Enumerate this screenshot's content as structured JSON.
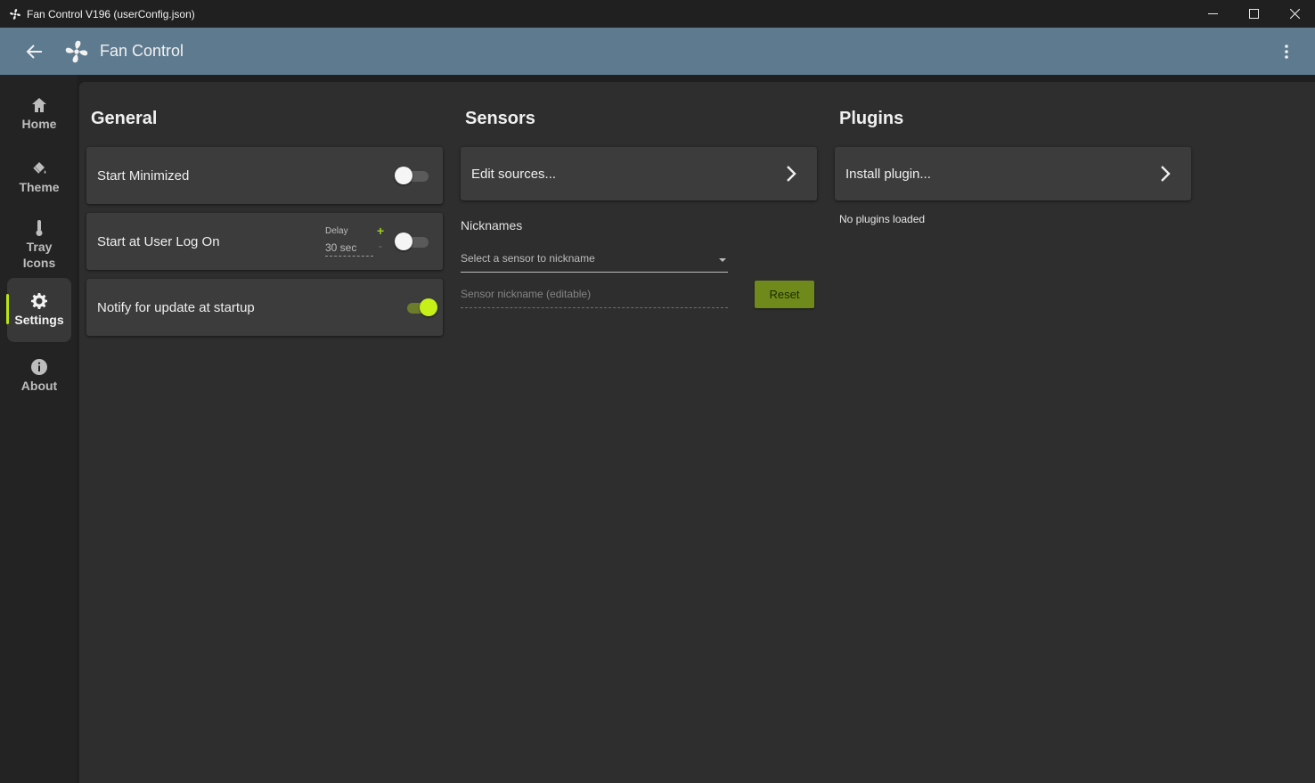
{
  "window": {
    "title": "Fan Control V196 (userConfig.json)"
  },
  "appbar": {
    "title": "Fan Control"
  },
  "nav": {
    "items": [
      {
        "label": "Home",
        "icon": "home-icon"
      },
      {
        "label": "Theme",
        "icon": "paint-bucket-icon"
      },
      {
        "label": "Tray Icons",
        "icon": "thermometer-icon"
      },
      {
        "label": "Settings",
        "icon": "gear-icon",
        "active": true
      },
      {
        "label": "About",
        "icon": "info-icon"
      }
    ]
  },
  "general": {
    "title": "General",
    "start_minimized": {
      "label": "Start Minimized",
      "enabled": false
    },
    "start_at_logon": {
      "label": "Start at User Log On",
      "enabled": false,
      "delay_label": "Delay",
      "delay_value": "30 sec",
      "plus": "+",
      "minus": "-"
    },
    "notify_update": {
      "label": "Notify for update at startup",
      "enabled": true
    }
  },
  "sensors": {
    "title": "Sensors",
    "edit_sources_label": "Edit sources...",
    "nicknames_title": "Nicknames",
    "select_placeholder": "Select a sensor to nickname",
    "nickname_placeholder": "Sensor nickname (editable)",
    "reset_label": "Reset"
  },
  "plugins": {
    "title": "Plugins",
    "install_label": "Install plugin...",
    "status": "No plugins loaded"
  },
  "colors": {
    "accent": "#c6f018",
    "appbar": "#5e7a8f",
    "reset_button": "#6f8a1a"
  }
}
